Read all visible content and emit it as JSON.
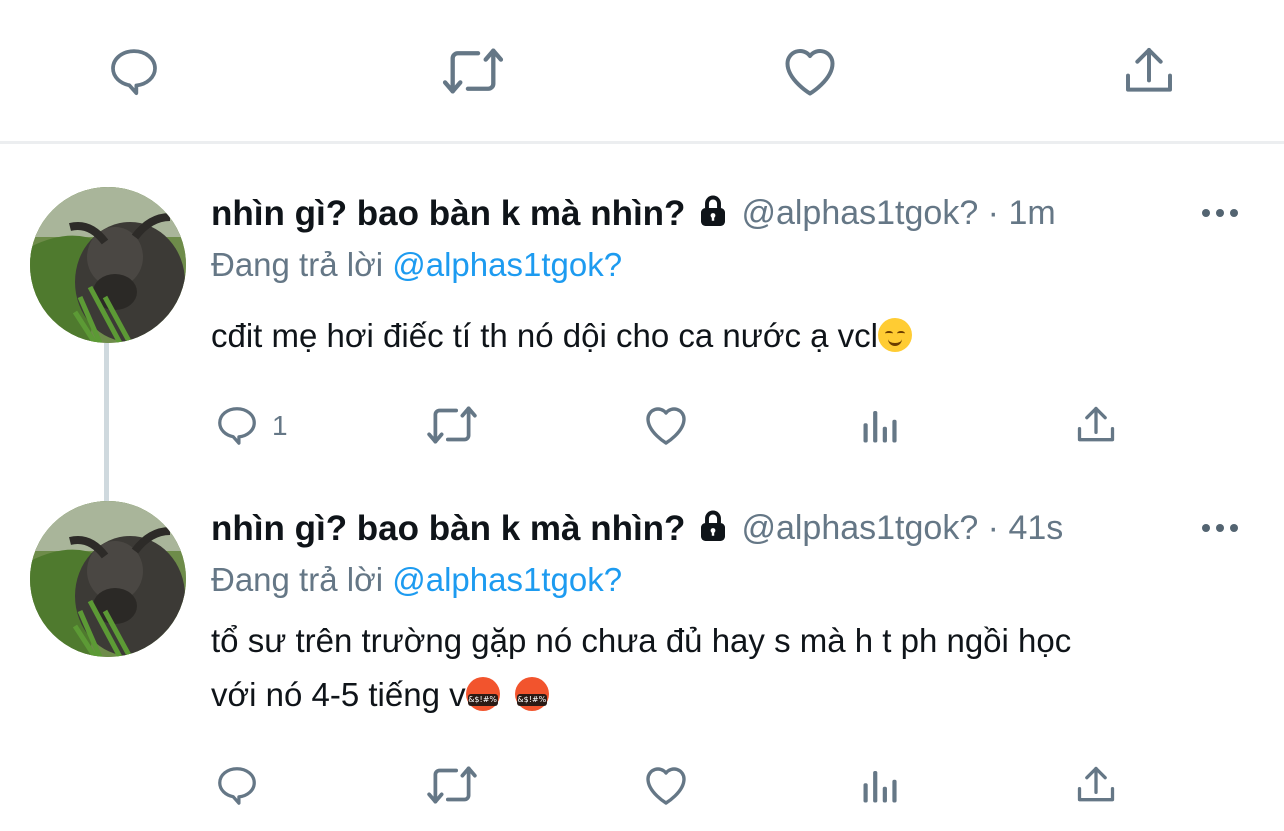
{
  "colors": {
    "muted": "#657786",
    "link": "#1d9bf0",
    "text": "#0f1419",
    "divider": "#eceef0"
  },
  "top_action_bar": {
    "icons": [
      "reply-icon",
      "retweet-icon",
      "like-icon",
      "share-icon"
    ]
  },
  "tweets": [
    {
      "name": "nhìn gì? bao bàn k mà nhìn?",
      "handle_time": "@alphas1tgok? · 1m",
      "replying_prefix": "Đang trả lời ",
      "replying_to": "@alphas1tgok?",
      "text": "cđit mẹ hơi điếc tí th nó dội cho ca nước ạ vcl",
      "emoji": "relieved-face",
      "reply_count": "1"
    },
    {
      "name": "nhìn gì? bao bàn k mà nhìn?",
      "handle_time": "@alphas1tgok? · 41s",
      "replying_prefix": "Đang trả lời ",
      "replying_to": "@alphas1tgok?",
      "text_line1": "tổ sư trên trường gặp nó chưa đủ hay s mà h t ph ngồi học",
      "text_line2": "với nó 4-5 tiếng v",
      "emoji": "face-with-symbols-on-mouth",
      "emoji_text": "&$!#%",
      "reply_count": ""
    }
  ]
}
